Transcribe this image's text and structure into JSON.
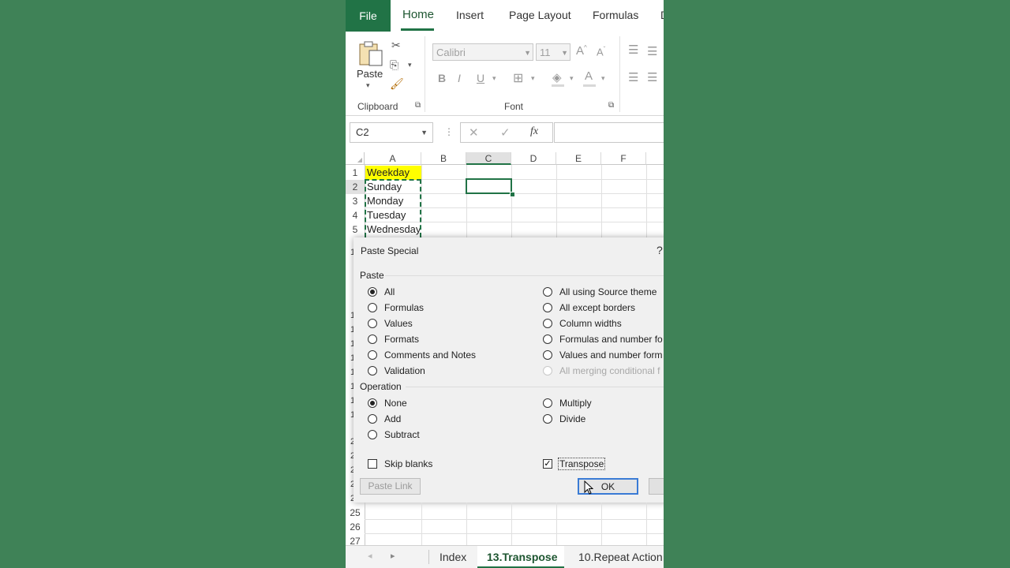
{
  "ribbon": {
    "tabs": {
      "file": "File",
      "home": "Home",
      "insert": "Insert",
      "page_layout": "Page Layout",
      "formulas": "Formulas",
      "data": "D"
    },
    "clipboard": {
      "paste": "Paste",
      "group_label": "Clipboard"
    },
    "font": {
      "name": "Calibri",
      "size": "11",
      "group_label": "Font",
      "bold": "B",
      "italic": "I",
      "underline": "U"
    }
  },
  "formula_bar": {
    "name_box": "C2",
    "fx": "fx"
  },
  "grid": {
    "columns": [
      "A",
      "B",
      "C",
      "D",
      "E",
      "F"
    ],
    "rows": [
      "1",
      "2",
      "3",
      "4",
      "5"
    ],
    "cells": [
      "Weekday",
      "Sunday",
      "Monday",
      "Tuesday",
      "Wednesday"
    ],
    "lower_rows": [
      "25",
      "26",
      "27"
    ],
    "hidden_row_stubs": [
      "1",
      "1",
      "1",
      "1",
      "1",
      "1",
      "1",
      "1",
      "1",
      "2",
      "2",
      "2",
      "2",
      "2",
      "2"
    ]
  },
  "dialog": {
    "title": "Paste Special",
    "help": "?",
    "paste_section": "Paste",
    "paste_left": [
      "All",
      "Formulas",
      "Values",
      "Formats",
      "Comments and Notes",
      "Validation"
    ],
    "paste_right": [
      "All using Source theme",
      "All except borders",
      "Column widths",
      "Formulas and number fo",
      "Values and number form",
      "All merging conditional f"
    ],
    "operation_section": "Operation",
    "operation_left": [
      "None",
      "Add",
      "Subtract"
    ],
    "operation_right": [
      "Multiply",
      "Divide"
    ],
    "skip_blanks": "Skip blanks",
    "transpose": "Transpose",
    "paste_link": "Paste Link",
    "ok": "OK"
  },
  "sheet_tabs": {
    "index": "Index",
    "active": "13.Transpose",
    "next": "10.Repeat Action"
  },
  "colors": {
    "accent": "#217346",
    "background": "#3f8257",
    "highlight": "#ffff00"
  }
}
